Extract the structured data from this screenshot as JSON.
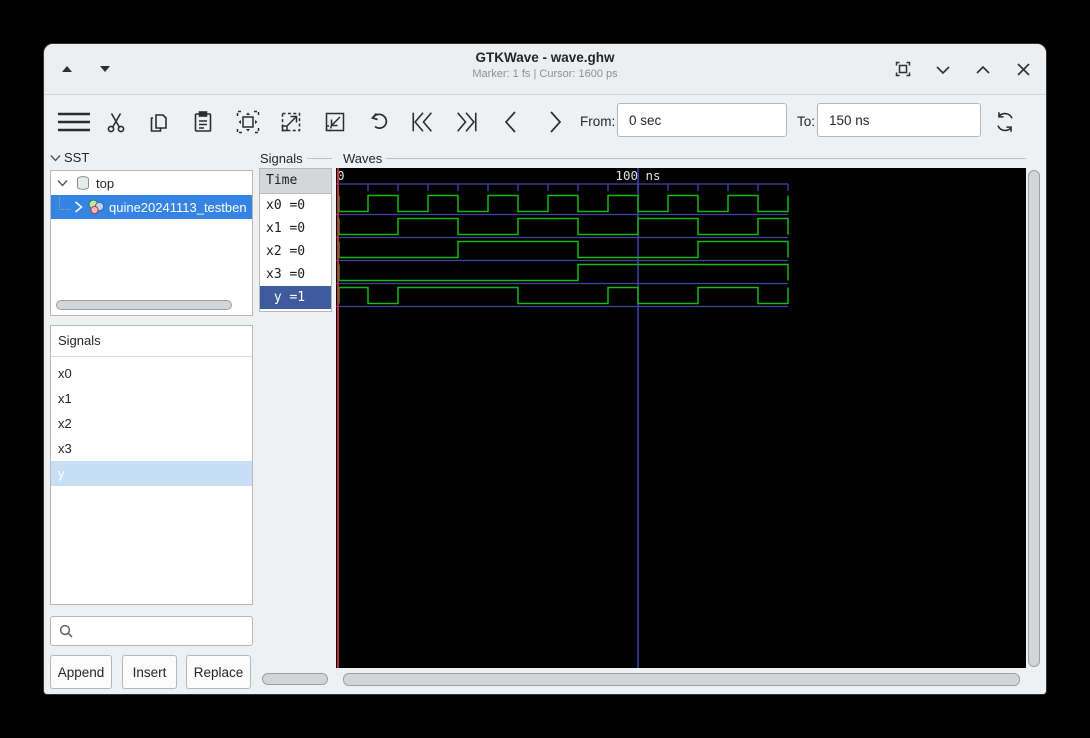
{
  "window": {
    "title": "GTKWave - wave.ghw",
    "status": "Marker: 1 fs  |  Cursor: 1600 ps"
  },
  "toolbar": {
    "from_label": "From:",
    "from_value": "0 sec",
    "to_label": "To:",
    "to_value": "150 ns"
  },
  "sst": {
    "header": "SST",
    "tree": [
      {
        "label": "top"
      },
      {
        "label": "quine20241113_testben",
        "selected": true
      }
    ]
  },
  "signal_list": {
    "header": "Signals",
    "items": [
      "x0",
      "x1",
      "x2",
      "x3",
      "y"
    ],
    "selected": "y"
  },
  "search": {
    "placeholder": ""
  },
  "buttons": {
    "append": "Append",
    "insert": "Insert",
    "replace": "Replace"
  },
  "signals_panel": {
    "label": "Signals",
    "time_header": "Time",
    "rows": [
      {
        "text": "x0 =0"
      },
      {
        "text": "x1 =0"
      },
      {
        "text": "x2 =0"
      },
      {
        "text": "x3 =0"
      },
      {
        "text": " y =1",
        "selected": true
      }
    ]
  },
  "waves": {
    "label": "Waves"
  },
  "chart_data": {
    "type": "digital-waveform",
    "time_unit": "ns",
    "t_start": 0,
    "t_end": 150,
    "tick_interval": 10,
    "tick_labels": [
      {
        "t": 0,
        "label": "0"
      },
      {
        "t": 100,
        "label": "100 ns"
      }
    ],
    "marker_t": 0,
    "cursor_t": 100,
    "series": [
      {
        "name": "x0",
        "initial": 0,
        "transitions": [
          10,
          20,
          30,
          40,
          50,
          60,
          70,
          80,
          90,
          100,
          110,
          120,
          130,
          140
        ]
      },
      {
        "name": "x1",
        "initial": 0,
        "transitions": [
          20,
          40,
          60,
          80,
          100,
          120,
          140
        ]
      },
      {
        "name": "x2",
        "initial": 0,
        "transitions": [
          40,
          80,
          120
        ]
      },
      {
        "name": "x3",
        "initial": 0,
        "transitions": [
          80
        ]
      },
      {
        "name": "y",
        "initial": 1,
        "transitions": [
          10,
          20,
          60,
          90,
          100,
          120,
          140
        ]
      }
    ],
    "values_at_marker": {
      "x0": 0,
      "x1": 0,
      "x2": 0,
      "x3": 0,
      "y": 1
    }
  },
  "colors": {
    "wave_green": "#19b819",
    "grid_blue": "#4343a6",
    "cursor_blue": "#4a4ec4",
    "marker_red": "#d03434",
    "canvas_bg": "#010101",
    "tree_selection": "#3584e4",
    "name_selection": "#3d5b9d",
    "list_selection": "#c7dff4",
    "timeline_text": "#e0e1e1"
  }
}
